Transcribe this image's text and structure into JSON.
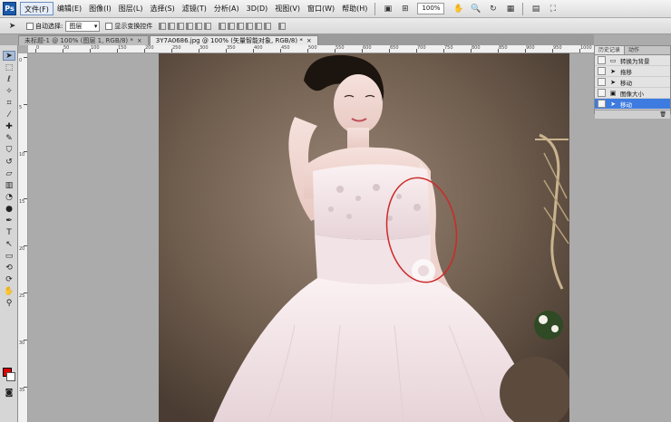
{
  "app": {
    "logo": "Ps"
  },
  "menubar": {
    "items": [
      "文件(F)",
      "编辑(E)",
      "图像(I)",
      "图层(L)",
      "选择(S)",
      "滤镜(T)",
      "分析(A)",
      "3D(D)",
      "视图(V)",
      "窗口(W)",
      "帮助(H)"
    ],
    "zoom": "100%"
  },
  "options": {
    "auto_select_label": "自动选择:",
    "auto_select_value": "图层",
    "show_transform_label": "显示变换控件"
  },
  "tabs": [
    {
      "label": "未标题-1 @ 100% (图层 1, RGB/8) *",
      "close": "×"
    },
    {
      "label": "3Y7A0686.jpg @ 100% (矢量智能对象, RGB/8) *",
      "close": "×"
    }
  ],
  "rulers": {
    "top": [
      "0",
      "50",
      "100",
      "150",
      "200",
      "250",
      "300",
      "350",
      "400",
      "450",
      "500",
      "550",
      "600",
      "650",
      "700",
      "750",
      "800",
      "850",
      "900",
      "950",
      "1000"
    ],
    "left": [
      "0",
      "5",
      "10",
      "15",
      "20",
      "25",
      "30",
      "35"
    ]
  },
  "history": {
    "tabs": [
      "历史记录",
      "动作"
    ],
    "items": [
      {
        "label": "转换为背景",
        "icon": "layer-icon"
      },
      {
        "label": "拖移",
        "icon": "move-icon"
      },
      {
        "label": "移动",
        "icon": "move-icon"
      },
      {
        "label": "图像大小",
        "icon": "image-size-icon"
      },
      {
        "label": "移动",
        "icon": "move-icon"
      }
    ],
    "selected_index": 4
  },
  "colors": {
    "foreground": "#e00000",
    "background": "#ffffff",
    "annotation": "#cc2a2a",
    "history_selected": "#3d7be0"
  }
}
